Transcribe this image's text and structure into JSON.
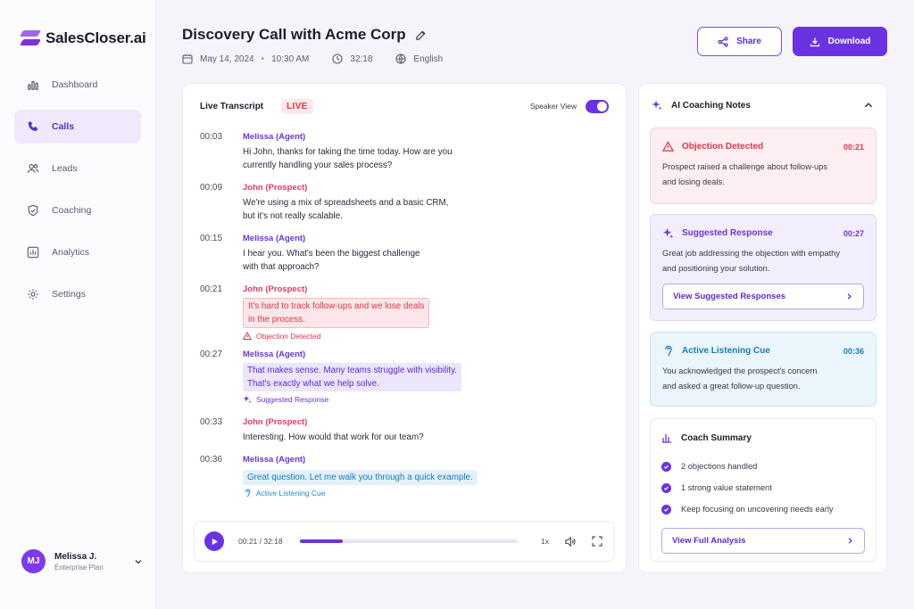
{
  "brand": {
    "name": "SalesCloser.ai"
  },
  "nav": [
    {
      "label": "Dashboard",
      "icon": "bar-chart-icon",
      "active": false
    },
    {
      "label": "Calls",
      "icon": "phone-icon",
      "active": true
    },
    {
      "label": "Leads",
      "icon": "users-icon",
      "active": false
    },
    {
      "label": "Coaching",
      "icon": "shield-check-icon",
      "active": false
    },
    {
      "label": "Analytics",
      "icon": "analytics-icon",
      "active": false
    },
    {
      "label": "Settings",
      "icon": "gear-icon",
      "active": false
    }
  ],
  "user": {
    "initials": "MJ",
    "name": "Melissa J.",
    "plan": "Enterprise Plan"
  },
  "header": {
    "title": "Discovery Call with Acme Corp",
    "date": "May 14, 2024",
    "time": "10:30 AM",
    "duration": "32:18",
    "language": "English",
    "share_label": "Share",
    "download_label": "Download"
  },
  "transcript": {
    "title": "Live Transcript",
    "live_label": "LIVE",
    "speaker_view_label": "Speaker View",
    "speaker_view_on": true,
    "messages": [
      {
        "time": "00:03",
        "speaker": "Melissa (Agent)",
        "role": "agent",
        "lines": [
          "Hi John, thanks for taking the time today. How are you",
          "currently handling your sales process?"
        ]
      },
      {
        "time": "00:09",
        "speaker": "John (Prospect)",
        "role": "prospect",
        "lines": [
          "We're using a mix of spreadsheets and a basic CRM,",
          "but it's not really scalable."
        ]
      },
      {
        "time": "00:15",
        "speaker": "Melissa (Agent)",
        "role": "agent",
        "lines": [
          "I hear you. What's been the biggest challenge",
          "with that approach?"
        ]
      },
      {
        "time": "00:21",
        "speaker": "John (Prospect)",
        "role": "prospect",
        "lines": [
          "It's hard to track follow-ups and we lose deals",
          "in the process."
        ],
        "highlight": "red",
        "tag": "Objection Detected"
      },
      {
        "time": "00:27",
        "speaker": "Melissa (Agent)",
        "role": "agent",
        "lines": [
          "That makes sense. Many teams struggle with visibility.",
          "That's exactly what we help solve."
        ],
        "highlight": "purple",
        "tag": "Suggested Response"
      },
      {
        "time": "00:33",
        "speaker": "John (Prospect)",
        "role": "prospect",
        "lines": [
          "Interesting. How would that work for our team?"
        ]
      },
      {
        "time": "00:36",
        "speaker": "Melissa (Agent)",
        "role": "agent",
        "lines": [
          "Great question. Let me walk you through a quick example."
        ],
        "highlight": "blue",
        "tag": "Active Listening Cue"
      }
    ]
  },
  "player": {
    "position": "00:21 / 32:18",
    "progress_fraction": 0.195,
    "speed": "1x"
  },
  "coaching": {
    "title": "AI Coaching Notes",
    "notes": [
      {
        "type": "red",
        "title": "Objection Detected",
        "time": "00:21",
        "lines": [
          "Prospect raised a challenge about follow-ups",
          "and losing deals."
        ]
      },
      {
        "type": "purple",
        "title": "Suggested Response",
        "time": "00:27",
        "lines": [
          "Great job addressing the objection with empathy",
          "and positioning your solution."
        ],
        "button": "View Suggested Responses"
      },
      {
        "type": "blue",
        "title": "Active Listening Cue",
        "time": "00:36",
        "lines": [
          "You acknowledged the prospect's concern",
          "and asked a great follow-up question."
        ]
      }
    ],
    "summary": {
      "title": "Coach Summary",
      "items": [
        "2 objections handled",
        "1 strong value statement",
        "Keep focusing on uncovering needs early"
      ],
      "button": "View Full Analysis"
    }
  },
  "colors": {
    "accent": "#6a32e0",
    "danger": "#e0354b",
    "info": "#1c7ab8"
  }
}
